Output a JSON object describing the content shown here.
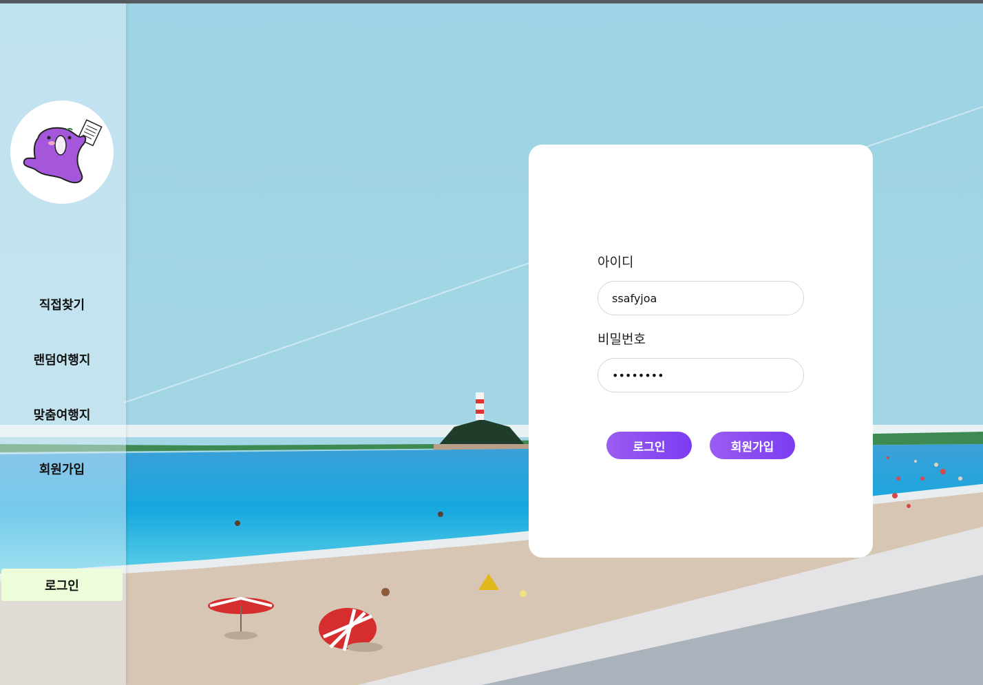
{
  "sidebar": {
    "logo_icon": "purple-blob-mascot-holding-paper",
    "items": [
      {
        "label": "직접찾기"
      },
      {
        "label": "랜덤여행지"
      },
      {
        "label": "맞춤여행지"
      },
      {
        "label": "회원가입"
      }
    ],
    "login_label": "로그인"
  },
  "login_form": {
    "id_label": "아이디",
    "id_value": "ssafyjoa",
    "password_label": "비밀번호",
    "password_value": "ssafyjoa",
    "login_button": "로그인",
    "signup_button": "회원가입"
  },
  "colors": {
    "accent": "#7b3cf2",
    "login_nav_bg": "#eefdd9",
    "sky": "#9fd3e3",
    "sea": "#1aa9dd",
    "sand": "#d8c6b5"
  }
}
